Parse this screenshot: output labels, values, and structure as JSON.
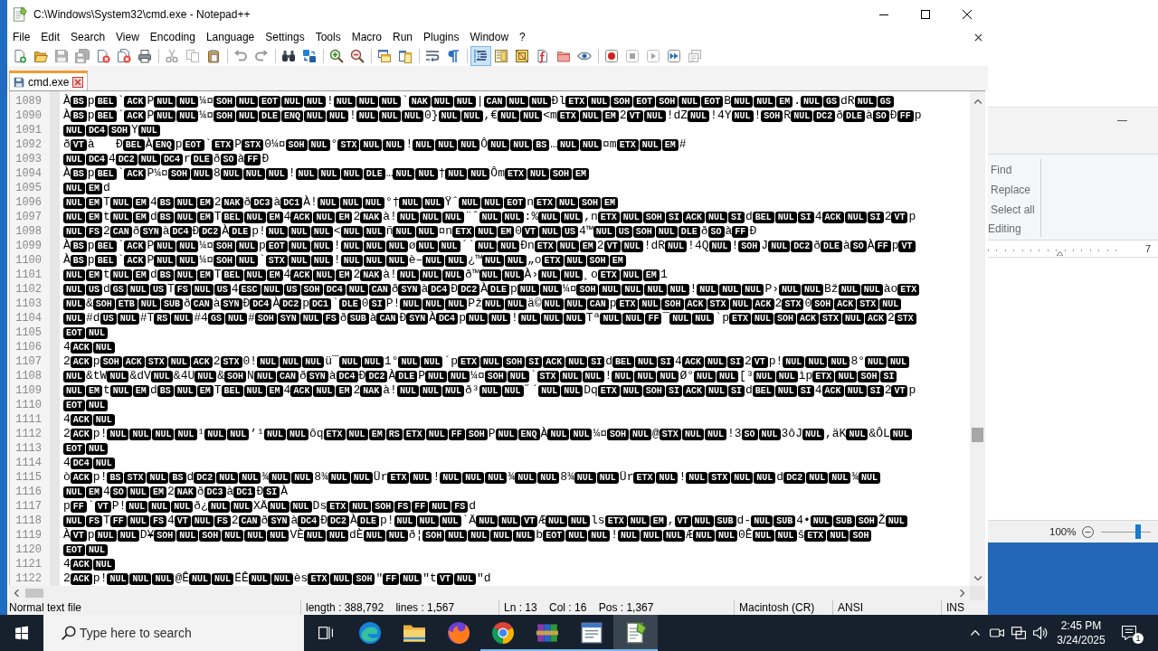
{
  "window": {
    "title": "C:\\Windows\\System32\\cmd.exe - Notepad++"
  },
  "menu": [
    "File",
    "Edit",
    "Search",
    "View",
    "Encoding",
    "Language",
    "Settings",
    "Tools",
    "Macro",
    "Run",
    "Plugins",
    "Window",
    "?"
  ],
  "toolbar": [
    {
      "pressed": false,
      "disabled": false
    },
    {
      "pressed": false,
      "disabled": false
    },
    {
      "pressed": false,
      "disabled": true
    },
    {
      "pressed": false,
      "disabled": true
    },
    {
      "pressed": false,
      "disabled": false
    },
    {
      "pressed": false,
      "disabled": false
    },
    {
      "pressed": false,
      "disabled": false
    },
    {
      "pressed": false,
      "disabled": true
    },
    {
      "pressed": false,
      "disabled": true
    },
    {
      "pressed": false,
      "disabled": false
    },
    {
      "pressed": false,
      "disabled": true
    },
    {
      "pressed": false,
      "disabled": true
    },
    {
      "pressed": false,
      "disabled": false
    },
    {
      "pressed": false,
      "disabled": false
    },
    {
      "pressed": false,
      "disabled": false
    },
    {
      "pressed": false,
      "disabled": false
    },
    {
      "pressed": false,
      "disabled": false
    },
    {
      "pressed": false,
      "disabled": false
    },
    {
      "pressed": false,
      "disabled": false
    },
    {
      "pressed": false,
      "disabled": false
    },
    {
      "pressed": true,
      "disabled": false
    },
    {
      "pressed": false,
      "disabled": false
    },
    {
      "pressed": false,
      "disabled": false
    },
    {
      "pressed": false,
      "disabled": false
    },
    {
      "pressed": false,
      "disabled": false
    },
    {
      "pressed": false,
      "disabled": false
    },
    {
      "pressed": false,
      "disabled": false
    },
    {
      "pressed": false,
      "disabled": true
    },
    {
      "pressed": false,
      "disabled": true
    },
    {
      "pressed": false,
      "disabled": false
    },
    {
      "pressed": false,
      "disabled": true
    }
  ],
  "tabs": [
    {
      "label": "cmd.exe",
      "selected": true
    }
  ],
  "editor": {
    "lines": [
      {
        "num": "1089",
        "segs": [
          "À",
          [
            "BS"
          ],
          "p",
          [
            "BEL"
          ],
          "`",
          [
            "ACK"
          ],
          "P",
          [
            "NUL",
            "NUL"
          ],
          "¼¤",
          [
            "SOH",
            "NUL",
            "EOT",
            "NUL",
            "NUL"
          ],
          "!",
          [
            "NUL",
            "NUL",
            "NUL"
          ],
          "`",
          [
            "NAK",
            "NUL",
            "NUL"
          ],
          "|",
          [
            "CAN",
            "NUL",
            "NUL"
          ],
          "Ðl",
          [
            "ETX",
            "NUL",
            "SOH",
            "EOT",
            "SOH",
            "NUL",
            "EOT"
          ],
          "B",
          [
            "NUL",
            "NUL",
            "EM"
          ],
          ".",
          [
            "NUL",
            "GS"
          ],
          "dR",
          [
            "NUL",
            "GS"
          ]
        ]
      },
      {
        "num": "1090",
        "segs": [
          "À",
          [
            "BS"
          ],
          "p",
          [
            "BEL"
          ],
          "`",
          [
            "ACK"
          ],
          "P",
          [
            "NUL",
            "NUL"
          ],
          "¼¤",
          [
            "SOH",
            "NUL",
            "DLE",
            "ENQ",
            "NUL",
            "NUL"
          ],
          "!",
          [
            "NUL",
            "NUL",
            "NUL"
          ],
          "0}",
          [
            "NUL",
            "NUL"
          ],
          ",€",
          [
            "NUL",
            "NUL"
          ],
          "<m",
          [
            "ETX",
            "NUL",
            "EM"
          ],
          "2",
          [
            "VT",
            "NUL"
          ],
          "!dZ",
          [
            "NUL"
          ],
          "!4Y",
          [
            "NUL"
          ],
          "!",
          [
            "SOH"
          ],
          "R",
          [
            "NUL",
            "DC2"
          ],
          "ð",
          [
            "DLE"
          ],
          "à",
          [
            "SO"
          ],
          "Ð",
          [
            "FF"
          ],
          "p"
        ]
      },
      {
        "num": "1091",
        "segs": [
          [
            "NUL",
            "DC4",
            "SOH"
          ],
          "Y",
          [
            "NUL"
          ]
        ]
      },
      {
        "num": "1092",
        "segs": [
          "ð",
          [
            "VT"
          ],
          "à   Ð",
          [
            "BEL"
          ],
          "À",
          [
            "ENQ"
          ],
          "p",
          [
            "EOT"
          ],
          "`",
          [
            "ETX"
          ],
          "P",
          [
            "STX"
          ],
          "0¼¤",
          [
            "SOH",
            "NUL"
          ],
          "°",
          [
            "STX",
            "NUL",
            "NUL"
          ],
          "!",
          [
            "NUL",
            "NUL",
            "NUL"
          ],
          "Ô",
          [
            "NUL",
            "NUL",
            "BS"
          ],
          "…",
          [
            "NUL",
            "NUL"
          ],
          "¤m",
          [
            "ETX",
            "NUL",
            "EM"
          ],
          "#"
        ]
      },
      {
        "num": "1093",
        "segs": [
          [
            "NUL",
            "DC4"
          ],
          "4",
          [
            "DC2",
            "NUL",
            "DC4"
          ],
          "r",
          [
            "DLE"
          ],
          "ð",
          [
            "SO"
          ],
          "à",
          [
            "FF"
          ],
          "Ð"
        ]
      },
      {
        "num": "1094",
        "segs": [
          "À",
          [
            "BS"
          ],
          "p",
          [
            "BEL"
          ],
          "`",
          [
            "ACK"
          ],
          "P¼¤",
          [
            "SOH",
            "NUL"
          ],
          "8",
          [
            "NUL",
            "NUL",
            "NUL"
          ],
          "!",
          [
            "NUL",
            "NUL",
            "NUL",
            "DLE"
          ],
          "…",
          [
            "NUL",
            "NUL"
          ],
          "†",
          [
            "NUL",
            "NUL"
          ],
          "Ôm",
          [
            "ETX",
            "NUL",
            "SOH",
            "EM"
          ]
        ]
      },
      {
        "num": "1095",
        "segs": [
          [
            "NUL",
            "EM"
          ],
          "d"
        ]
      },
      {
        "num": "1096",
        "segs": [
          [
            "NUL",
            "EM"
          ],
          "T",
          [
            "NUL",
            "EM"
          ],
          "4",
          [
            "BS",
            "NUL",
            "EM"
          ],
          "2",
          [
            "NAK"
          ],
          "ð",
          [
            "DC3"
          ],
          "à",
          [
            "DC1"
          ],
          "À!",
          [
            "NUL",
            "NUL",
            "NUL"
          ],
          "°†",
          [
            "NUL",
            "NUL"
          ],
          "Ÿˆ",
          [
            "NUL",
            "NUL",
            "EOT"
          ],
          "n",
          [
            "ETX",
            "NUL",
            "SOH",
            "EM"
          ]
        ]
      },
      {
        "num": "1097",
        "segs": [
          [
            "NUL",
            "EM"
          ],
          "t",
          [
            "NUL",
            "EM"
          ],
          "d",
          [
            "BS",
            "NUL",
            "EM"
          ],
          "T",
          [
            "BEL",
            "NUL",
            "EM"
          ],
          "4",
          [
            "ACK",
            "NUL",
            "EM"
          ],
          "2",
          [
            "NAK"
          ],
          "à!",
          [
            "NUL",
            "NUL",
            "NUL"
          ],
          "¨ˆ",
          [
            "NUL",
            "NUL"
          ],
          ":%",
          [
            "NUL",
            "NUL"
          ],
          ",n",
          [
            "ETX",
            "NUL",
            "SOH",
            "SI",
            "ACK",
            "NUL",
            "SI"
          ],
          "d",
          [
            "BEL",
            "NUL",
            "SI"
          ],
          "4",
          [
            "ACK",
            "NUL",
            "SI"
          ],
          "2",
          [
            "VT"
          ],
          "p"
        ]
      },
      {
        "num": "1098",
        "segs": [
          [
            "NUL",
            "FS"
          ],
          "2",
          [
            "CAN"
          ],
          "ð",
          [
            "SYN"
          ],
          "à",
          [
            "DC4"
          ],
          "Ð",
          [
            "DC2"
          ],
          "À",
          [
            "DLE"
          ],
          "p!",
          [
            "NUL",
            "NUL",
            "NUL"
          ],
          "<",
          [
            "NUL",
            "NUL"
          ],
          "ñ",
          [
            "NUL",
            "NUL"
          ],
          "¤n",
          [
            "ETX",
            "NUL",
            "EM"
          ],
          "0",
          [
            "VT",
            "NUL",
            "US"
          ],
          "4™",
          [
            "NUL",
            "US",
            "SOH",
            "NUL",
            "DLE"
          ],
          "ð",
          [
            "SO"
          ],
          "à",
          [
            "FF"
          ],
          "Ð"
        ]
      },
      {
        "num": "1099",
        "segs": [
          "À",
          [
            "BS"
          ],
          "p",
          [
            "BEL"
          ],
          "`",
          [
            "ACK"
          ],
          "P",
          [
            "NUL",
            "NUL"
          ],
          "¼¤",
          [
            "SOH",
            "NUL"
          ],
          "p",
          [
            "EOT",
            "NUL",
            "NUL"
          ],
          "!",
          [
            "NUL",
            "NUL",
            "NUL"
          ],
          "ø",
          [
            "NUL",
            "NUL"
          ],
          "´`",
          [
            "NUL",
            "NUL"
          ],
          "Ðn",
          [
            "ETX",
            "NUL",
            "EM"
          ],
          "2",
          [
            "VT",
            "NUL"
          ],
          "!dR",
          [
            "NUL"
          ],
          "!4Q",
          [
            "NUL"
          ],
          "!",
          [
            "SOH"
          ],
          "J",
          [
            "NUL",
            "DC2"
          ],
          "ð",
          [
            "DLE"
          ],
          "à",
          [
            "SO"
          ],
          "À",
          [
            "FF"
          ],
          "p",
          [
            "VT"
          ]
        ]
      },
      {
        "num": "1100",
        "segs": [
          "À",
          [
            "BS"
          ],
          "p",
          [
            "BEL"
          ],
          "`",
          [
            "ACK"
          ],
          "P",
          [
            "NUL",
            "NUL"
          ],
          "¼¤",
          [
            "SOH",
            "NUL"
          ],
          "`",
          [
            "STX",
            "NUL",
            "NUL"
          ],
          "!",
          [
            "NUL",
            "NUL",
            "NUL"
          ],
          "è–",
          [
            "NUL",
            "NUL"
          ],
          "¿™",
          [
            "NUL",
            "NUL"
          ],
          "„o",
          [
            "ETX",
            "NUL",
            "SOH",
            "EM"
          ]
        ]
      },
      {
        "num": "1101",
        "segs": [
          [
            "NUL",
            "EM"
          ],
          "t",
          [
            "NUL",
            "EM"
          ],
          "d",
          [
            "BS",
            "NUL",
            "EM"
          ],
          "T",
          [
            "BEL",
            "NUL",
            "EM"
          ],
          "4",
          [
            "ACK",
            "NUL",
            "EM"
          ],
          "2",
          [
            "NAK"
          ],
          "à!",
          [
            "NUL",
            "NUL",
            "NUL"
          ],
          "ð™",
          [
            "NUL",
            "NUL"
          ],
          "À›",
          [
            "NUL",
            "NUL"
          ],
          "¸o",
          [
            "ETX",
            "NUL",
            "EM"
          ],
          "1"
        ]
      },
      {
        "num": "1102",
        "segs": [
          [
            "NUL",
            "US"
          ],
          "d",
          [
            "GS",
            "NUL",
            "US"
          ],
          "T",
          [
            "FS",
            "NUL",
            "US"
          ],
          "4",
          [
            "ESC",
            "NUL",
            "US",
            "SOH",
            "DC4",
            "NUL",
            "CAN"
          ],
          "ð",
          [
            "SYN"
          ],
          "à",
          [
            "DC4"
          ],
          "Ð",
          [
            "DC2"
          ],
          "À",
          [
            "DLE"
          ],
          "p",
          [
            "NUL",
            "NUL"
          ],
          "¼¤",
          [
            "SOH",
            "NUL",
            "NUL",
            "NUL",
            "NUL"
          ],
          "!",
          [
            "NUL",
            "NUL",
            "NUL"
          ],
          "P›",
          [
            "NUL",
            "NUL"
          ],
          "Bž",
          [
            "NUL",
            "NUL"
          ],
          "ào",
          [
            "ETX"
          ]
        ]
      },
      {
        "num": "1103",
        "segs": [
          [
            "NUL"
          ],
          "&",
          [
            "SOH",
            "ETB",
            "NUL",
            "SUB"
          ],
          "ð",
          [
            "CAN"
          ],
          "à",
          [
            "SYN"
          ],
          "Ð",
          [
            "DC4"
          ],
          "À",
          [
            "DC2"
          ],
          "p",
          [
            "DC1"
          ],
          "`",
          [
            "DLE"
          ],
          "0",
          [
            "SI"
          ],
          "P!",
          [
            "NUL",
            "NUL",
            "NUL"
          ],
          "Pž",
          [
            "NUL",
            "NUL"
          ],
          "ä©",
          [
            "NUL",
            "NUL",
            "CAN"
          ],
          "p",
          [
            "ETX",
            "NUL",
            "SOH",
            "ACK",
            "STX",
            "NUL",
            "ACK"
          ],
          "2",
          [
            "STX"
          ],
          "0",
          [
            "SOH",
            "ACK",
            "STX",
            "NUL"
          ]
        ]
      },
      {
        "num": "1104",
        "segs": [
          [
            "NUL"
          ],
          "#d",
          [
            "US",
            "NUL"
          ],
          "#T",
          [
            "RS",
            "NUL"
          ],
          "#4",
          [
            "GS",
            "NUL"
          ],
          "#",
          [
            "SOH",
            "SYN",
            "NUL",
            "FS"
          ],
          "ð",
          [
            "SUB"
          ],
          "à",
          [
            "CAN"
          ],
          "Ð",
          [
            "SYN"
          ],
          "À",
          [
            "DC4"
          ],
          "p",
          [
            "NUL",
            "NUL"
          ],
          "!",
          [
            "NUL",
            "NUL",
            "NUL"
          ],
          "Tª",
          [
            "NUL",
            "NUL",
            "FF"
          ],
          "¯",
          [
            "NUL",
            "NUL"
          ],
          "`p",
          [
            "ETX",
            "NUL",
            "SOH",
            "ACK",
            "STX",
            "NUL",
            "ACK"
          ],
          "2",
          [
            "STX"
          ]
        ]
      },
      {
        "num": "1105",
        "segs": [
          [
            "EOT",
            "NUL"
          ]
        ]
      },
      {
        "num": "1106",
        "segs": [
          "4",
          [
            "ACK",
            "NUL"
          ]
        ]
      },
      {
        "num": "1107",
        "segs": [
          "2",
          [
            "ACK"
          ],
          "p",
          [
            "SOH",
            "ACK",
            "STX",
            "NUL",
            "ACK"
          ],
          "2",
          [
            "STX"
          ],
          "0!",
          [
            "NUL",
            "NUL",
            "NUL"
          ],
          "ü¯",
          [
            "NUL",
            "NUL"
          ],
          "1°",
          [
            "NUL",
            "NUL"
          ],
          "´p",
          [
            "ETX",
            "NUL",
            "SOH",
            "SI",
            "ACK",
            "NUL",
            "SI"
          ],
          "d",
          [
            "BEL",
            "NUL",
            "SI"
          ],
          "4",
          [
            "ACK",
            "NUL",
            "SI"
          ],
          "2",
          [
            "VT"
          ],
          "p!",
          [
            "NUL",
            "NUL",
            "NUL"
          ],
          "8°",
          [
            "NUL",
            "NUL"
          ]
        ]
      },
      {
        "num": "1108",
        "segs": [
          [
            "NUL"
          ],
          "&tW",
          [
            "NUL"
          ],
          "&dV",
          [
            "NUL"
          ],
          "&4U",
          [
            "NUL"
          ],
          "&",
          [
            "SOH"
          ],
          "N",
          [
            "NUL",
            "CAN"
          ],
          "ð",
          [
            "SYN"
          ],
          "à",
          [
            "DC4"
          ],
          "Ð",
          [
            "DC2"
          ],
          "À",
          [
            "DLE"
          ],
          "P",
          [
            "NUL",
            "NUL"
          ],
          "¼¤",
          [
            "SOH",
            "NUL"
          ],
          "`",
          [
            "STX",
            "NUL",
            "NUL"
          ],
          "!",
          [
            "NUL",
            "NUL",
            "NUL"
          ],
          "Ø°",
          [
            "NUL",
            "NUL"
          ],
          "[³",
          [
            "NUL",
            "NUL"
          ],
          "ìp",
          [
            "ETX",
            "NUL",
            "SOH",
            "SI"
          ]
        ]
      },
      {
        "num": "1109",
        "segs": [
          [
            "NUL",
            "EM"
          ],
          "t",
          [
            "NUL",
            "EM"
          ],
          "d",
          [
            "BS",
            "NUL",
            "EM"
          ],
          "T",
          [
            "BEL",
            "NUL",
            "EM"
          ],
          "4",
          [
            "ACK",
            "NUL",
            "EM"
          ],
          "2",
          [
            "NAK"
          ],
          "à!",
          [
            "NUL",
            "NUL",
            "NUL"
          ],
          "ð³",
          [
            "NUL",
            "NUL"
          ],
          "˝´",
          [
            "NUL",
            "NUL"
          ],
          "Dq",
          [
            "ETX",
            "NUL",
            "SOH",
            "SI",
            "ACK",
            "NUL",
            "SI"
          ],
          "d",
          [
            "BEL",
            "NUL",
            "SI"
          ],
          "4",
          [
            "ACK",
            "NUL",
            "SI"
          ],
          "2",
          [
            "VT"
          ],
          "p"
        ]
      },
      {
        "num": "1110",
        "segs": [
          [
            "EOT",
            "NUL"
          ]
        ]
      },
      {
        "num": "1111",
        "segs": [
          "4",
          [
            "ACK",
            "NUL"
          ]
        ]
      },
      {
        "num": "1112",
        "segs": [
          "2",
          [
            "ACK"
          ],
          "p!",
          [
            "NUL",
            "NUL",
            "NUL",
            "NUL"
          ],
          "¹",
          [
            "NUL",
            "NUL"
          ],
          "’¹",
          [
            "NUL",
            "NUL"
          ],
          "ôq",
          [
            "ETX",
            "NUL",
            "EM",
            "RS",
            "ETX",
            "NUL",
            "FF",
            "SOH"
          ],
          "P",
          [
            "NUL",
            "ENQ"
          ],
          "À",
          [
            "NUL",
            "NUL"
          ],
          "¼¤",
          [
            "SOH",
            "NUL"
          ],
          "@",
          [
            "STX",
            "NUL",
            "NUL"
          ],
          "!3",
          [
            "SO",
            "NUL"
          ],
          "3ôJ",
          [
            "NUL"
          ],
          ",äK",
          [
            "NUL"
          ],
          "&ÔL",
          [
            "NUL"
          ]
        ]
      },
      {
        "num": "1113",
        "segs": [
          [
            "EOT",
            "NUL"
          ]
        ]
      },
      {
        "num": "1114",
        "segs": [
          "4",
          [
            "DC4",
            "NUL"
          ]
        ]
      },
      {
        "num": "1115",
        "segs": [
          "ò",
          [
            "ACK"
          ],
          "p!",
          [
            "BS",
            "STX",
            "NUL",
            "BS"
          ],
          "d",
          [
            "DC2",
            "NUL",
            "NUL"
          ],
          "¾",
          [
            "NUL",
            "NUL"
          ],
          "8¾",
          [
            "NUL",
            "NUL"
          ],
          "Ür",
          [
            "ETX",
            "NUL"
          ],
          "!",
          [
            "NUL",
            "NUL",
            "NUL"
          ],
          "¾",
          [
            "NUL",
            "NUL"
          ],
          "8¾",
          [
            "NUL",
            "NUL"
          ],
          "Ür",
          [
            "ETX",
            "NUL"
          ],
          "!",
          [
            "NUL",
            "STX",
            "NUL",
            "NUL"
          ],
          "d",
          [
            "DC2",
            "NUL",
            "NUL"
          ],
          "¾",
          [
            "NUL"
          ]
        ]
      },
      {
        "num": "1116",
        "segs": [
          [
            "NUL",
            "EM"
          ],
          "4",
          [
            "SO",
            "NUL",
            "EM"
          ],
          "2",
          [
            "NAK"
          ],
          "ð",
          [
            "DC3"
          ],
          "à",
          [
            "DC1"
          ],
          "Ð",
          [
            "SI"
          ],
          "À"
        ]
      },
      {
        "num": "1117",
        "segs": [
          "p",
          [
            "FF"
          ],
          "`",
          [
            "VT"
          ],
          "P!",
          [
            "NUL",
            "NUL",
            "NUL"
          ],
          "ð¿",
          [
            "NUL",
            "NUL"
          ],
          "XÄ",
          [
            "NUL",
            "NUL"
          ],
          "Ds",
          [
            "ETX",
            "NUL",
            "SOH",
            "FS",
            "FF",
            "NUL",
            "FS"
          ],
          "d"
        ]
      },
      {
        "num": "1118",
        "segs": [
          [
            "NUL",
            "FS"
          ],
          "T",
          [
            "FF",
            "NUL",
            "FS"
          ],
          "4",
          [
            "VT",
            "NUL",
            "FS"
          ],
          "2",
          [
            "CAN"
          ],
          "ð",
          [
            "SYN"
          ],
          "à",
          [
            "DC4"
          ],
          "Ð",
          [
            "DC2"
          ],
          "À",
          [
            "DLE"
          ],
          "p!",
          [
            "NUL",
            "NUL",
            "NUL"
          ],
          "`Ä",
          [
            "NUL",
            "NUL",
            "VT"
          ],
          "Æ",
          [
            "NUL",
            "NUL"
          ],
          "ls",
          [
            "ETX",
            "NUL",
            "EM"
          ],
          ",",
          [
            "VT",
            "NUL",
            "SUB"
          ],
          "d-",
          [
            "NUL",
            "SUB"
          ],
          "4•",
          [
            "NUL",
            "SUB",
            "SOH"
          ],
          "Ž",
          [
            "NUL"
          ]
        ]
      },
      {
        "num": "1119",
        "segs": [
          "À",
          [
            "VT"
          ],
          "p",
          [
            "NUL",
            "NUL"
          ],
          "D¥",
          [
            "SOH",
            "NUL",
            "SOH",
            "NUL",
            "NUL",
            "NUL"
          ],
          "VÈ",
          [
            "NUL",
            "NUL"
          ],
          "dÈ",
          [
            "NUL",
            "NUL"
          ],
          "ð¦",
          [
            "SOH",
            "NUL",
            "NUL",
            "NUL",
            "NUL"
          ],
          "b",
          [
            "EOT",
            "NUL",
            "NUL"
          ],
          "!",
          [
            "NUL",
            "NUL",
            "NUL"
          ],
          "Æ",
          [
            "NUL",
            "NUL"
          ],
          "0Ê",
          [
            "NUL",
            "NUL"
          ],
          "š",
          [
            "ETX",
            "NUL",
            "SOH"
          ]
        ]
      },
      {
        "num": "1120",
        "segs": [
          [
            "EOT",
            "NUL"
          ]
        ]
      },
      {
        "num": "1121",
        "segs": [
          "4",
          [
            "ACK",
            "NUL"
          ]
        ]
      },
      {
        "num": "1122",
        "segs": [
          "2",
          [
            "ACK"
          ],
          "p!",
          [
            "NUL",
            "NUL",
            "NUL"
          ],
          "@Ê",
          [
            "NUL",
            "NUL"
          ],
          "ËÊ",
          [
            "NUL",
            "NUL"
          ],
          "ès",
          [
            "ETX",
            "NUL",
            "SOH"
          ],
          "\"",
          [
            "FF",
            "NUL"
          ],
          "\"t",
          [
            "VT",
            "NUL"
          ],
          "\"d"
        ]
      }
    ]
  },
  "status_bar": [
    "Normal text file",
    "length : 388,792    lines : 1,567",
    "Ln : 13    Col : 16    Pos : 1,367",
    "Macintosh (CR)",
    "ANSI",
    "INS"
  ],
  "background_window": {
    "ribbon": [
      "Find",
      "Replace",
      "Select all"
    ],
    "group_label": "Editing",
    "ruler_mark": "7",
    "zoom": {
      "reading": "100%",
      "level": 0.73
    }
  },
  "taskbar": {
    "search": {
      "placeholder": "Type here to search"
    },
    "apps": [
      {
        "selected": false,
        "running": false
      },
      {
        "selected": false,
        "running": false
      },
      {
        "selected": false,
        "running": false
      },
      {
        "selected": false,
        "running": true
      },
      {
        "selected": false,
        "running": true
      },
      {
        "selected": false,
        "running": true
      },
      {
        "selected": true,
        "running": true
      }
    ],
    "clock": {
      "time": "2:45 PM",
      "date": "3/24/2025"
    },
    "notifications": "1"
  }
}
